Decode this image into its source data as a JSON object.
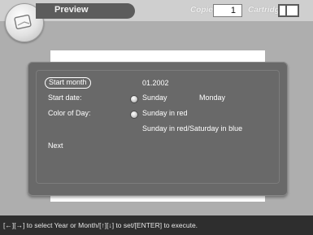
{
  "header": {
    "title": "Preview",
    "copies_label": "Copies",
    "copies_value": "1",
    "cartridge_label": "Cartridge"
  },
  "form": {
    "start_month_label": "Start month",
    "start_month_value": "01.2002",
    "start_date_label": "Start date:",
    "start_date_options": [
      "Sunday",
      "Monday"
    ],
    "color_of_day_label": "Color of Day:",
    "color_options": [
      "Sunday in red",
      "Sunday in red/Saturday in blue"
    ],
    "next_label": "Next"
  },
  "help": {
    "text": "[←][→] to select Year or Month/[↑][↓] to set/[ENTER] to execute."
  }
}
